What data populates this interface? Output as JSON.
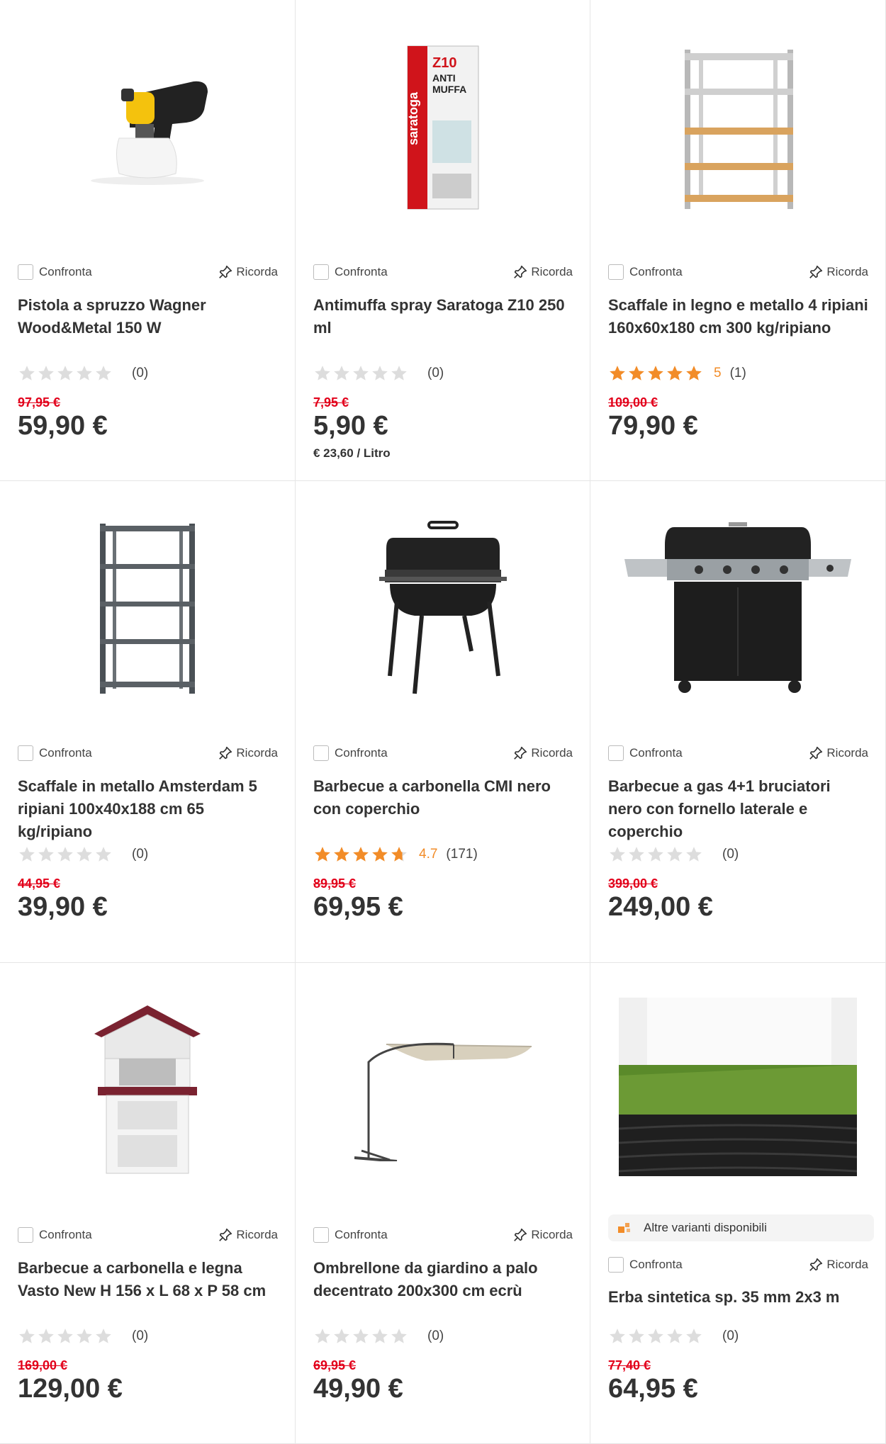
{
  "labels": {
    "compare": "Confronta",
    "remember": "Ricorda",
    "variants": "Altre varianti disponibili"
  },
  "colors": {
    "sale_price": "#e2001a",
    "star_filled": "#f28c28",
    "star_empty": "#dddddd",
    "text": "#333333"
  },
  "products": [
    {
      "image_icon": "paint-sprayer",
      "title": "Pistola a spruzzo Wagner Wood&Metal 150 W",
      "rating": 0,
      "rating_text": "",
      "review_count": "(0)",
      "old_price": "97,95 €",
      "price": "59,90 €",
      "unit_price": ""
    },
    {
      "image_icon": "spray-can",
      "title": "Antimuffa spray Saratoga Z10 250 ml",
      "rating": 0,
      "rating_text": "",
      "review_count": "(0)",
      "old_price": "7,95 €",
      "price": "5,90 €",
      "unit_price": "€ 23,60 / Litro"
    },
    {
      "image_icon": "wood-metal-shelf",
      "title": "Scaffale in legno e metallo 4 ripiani 160x60x180 cm 300 kg/ripiano",
      "rating": 5,
      "rating_text": "5",
      "review_count": "(1)",
      "old_price": "109,00 €",
      "price": "79,90 €",
      "unit_price": ""
    },
    {
      "image_icon": "metal-shelf",
      "title": "Scaffale in metallo Amsterdam 5 ripiani 100x40x188 cm 65 kg/ripiano",
      "rating": 0,
      "rating_text": "",
      "review_count": "(0)",
      "old_price": "44,95 €",
      "price": "39,90 €",
      "unit_price": ""
    },
    {
      "image_icon": "charcoal-barbecue",
      "title": "Barbecue a carbonella CMI nero con coperchio",
      "rating": 4.7,
      "rating_text": "4.7",
      "review_count": "(171)",
      "old_price": "89,95 €",
      "price": "69,95 €",
      "unit_price": ""
    },
    {
      "image_icon": "gas-barbecue",
      "title": "Barbecue a gas 4+1 bruciatori nero con fornello laterale e coperchio",
      "rating": 0,
      "rating_text": "",
      "review_count": "(0)",
      "old_price": "399,00 €",
      "price": "249,00 €",
      "unit_price": ""
    },
    {
      "image_icon": "masonry-barbecue",
      "title": "Barbecue a carbonella e legna Vasto New H 156 x L 68 x P 58 cm",
      "rating": 0,
      "rating_text": "",
      "review_count": "(0)",
      "old_price": "169,00 €",
      "price": "129,00 €",
      "unit_price": ""
    },
    {
      "image_icon": "cantilever-umbrella",
      "title": "Ombrellone da giardino a palo decentrato 200x300 cm ecrù",
      "rating": 0,
      "rating_text": "",
      "review_count": "(0)",
      "old_price": "69,95 €",
      "price": "49,90 €",
      "unit_price": ""
    },
    {
      "image_icon": "artificial-grass",
      "title": "Erba sintetica sp. 35 mm 2x3 m",
      "rating": 0,
      "rating_text": "",
      "review_count": "(0)",
      "old_price": "77,40 €",
      "price": "64,95 €",
      "unit_price": "",
      "has_variants": true
    }
  ]
}
